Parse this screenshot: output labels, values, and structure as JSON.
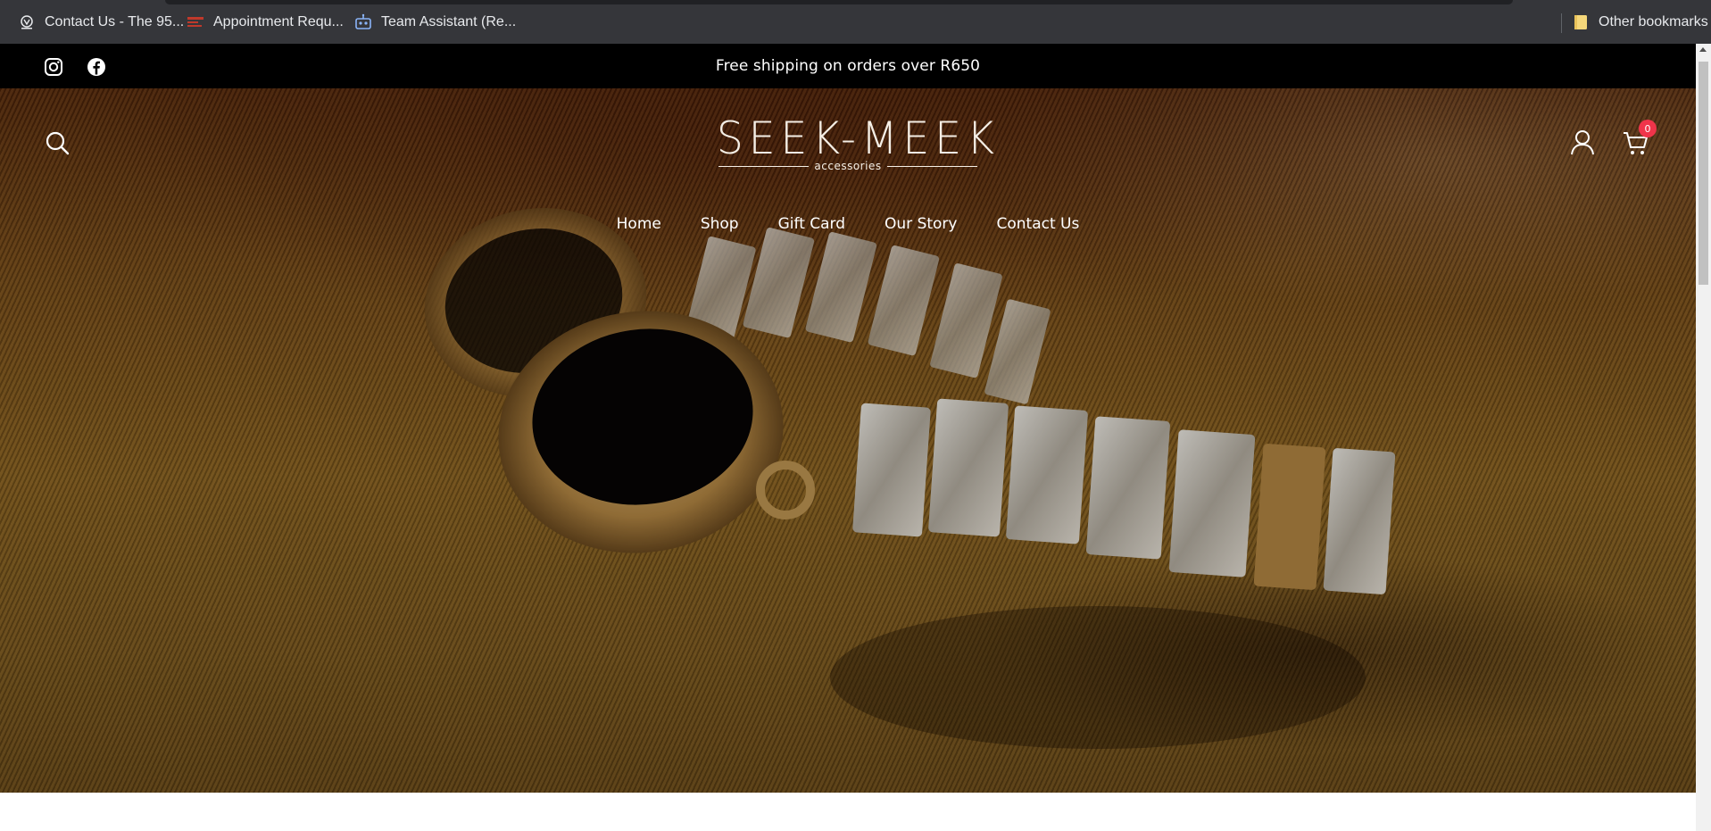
{
  "bookmarks": {
    "items": [
      {
        "label": "Contact Us - The 95...",
        "icon": "site-logo-icon"
      },
      {
        "label": "Appointment Requ...",
        "icon": "form-icon"
      },
      {
        "label": "Team Assistant (Re...",
        "icon": "robot-icon"
      }
    ],
    "other": {
      "label": "Other bookmarks",
      "icon": "folder-icon"
    }
  },
  "announcement": {
    "message": "Free shipping on orders over R650",
    "socials": [
      "instagram-icon",
      "facebook-icon"
    ]
  },
  "header": {
    "logo_main": "SEEK-MEEK",
    "logo_sub": "accessories",
    "cart_count": "0",
    "icons": [
      "search-icon",
      "account-icon",
      "cart-icon"
    ]
  },
  "nav": {
    "items": [
      "Home",
      "Shop",
      "Gift Card",
      "Our Story",
      "Contact Us"
    ]
  },
  "colors": {
    "announce_bg": "#000000",
    "badge": "#f0344a",
    "bookmarks_bg": "#35363a"
  }
}
